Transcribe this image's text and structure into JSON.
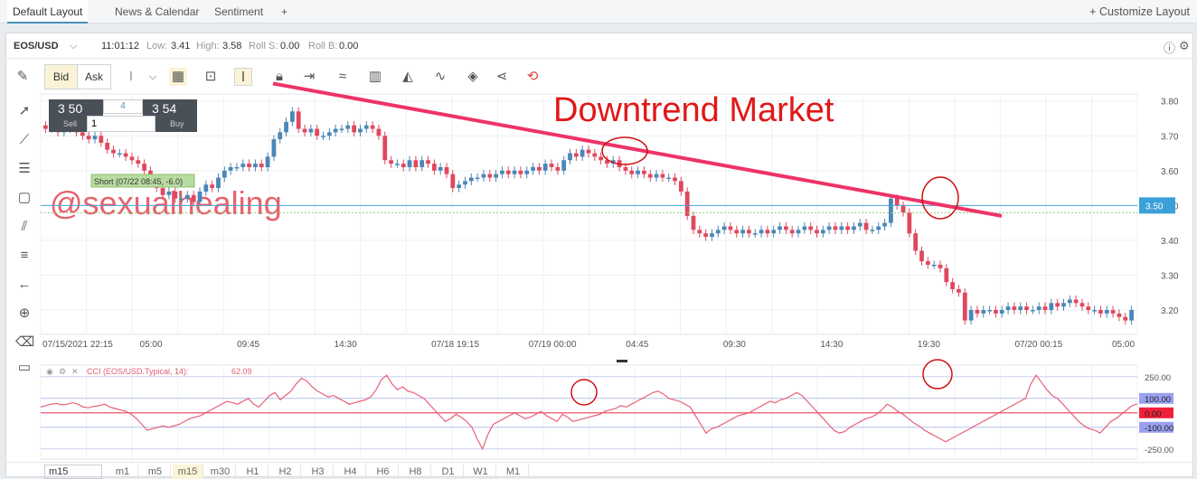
{
  "tabs": {
    "items": [
      "Default Layout",
      "News & Calendar",
      "Sentiment",
      "+"
    ],
    "customize": "+ Customize Layout"
  },
  "infobar": {
    "symbol": "EOS/USD",
    "chevron": "⌵",
    "time": "11:01:12",
    "low_label": "Low:",
    "low": "3.41",
    "high_label": "High:",
    "high": "3.58",
    "roll_s_label": "Roll S:",
    "roll_s": "0.00",
    "roll_b_label": "Roll B:",
    "roll_b": "0.00",
    "info_icon": "ⓘ",
    "settings_icon": "⚙"
  },
  "toolbar": {
    "bid": "Bid",
    "ask": "Ask"
  },
  "widget": {
    "sell_price": "3 50",
    "buy_price": "3 54",
    "sell_label": "Sell",
    "buy_label": "Buy",
    "spread": "4",
    "qty": "1"
  },
  "chart_data": {
    "type": "candlestick",
    "title": "Downtrend Market",
    "watermark": "@sexualhealing",
    "order_label": "Short (07/22 08:45, -6.0)",
    "current_price": "3.50",
    "ylim": [
      3.13,
      3.82
    ],
    "y_ticks": [
      "3.80",
      "3.70",
      "3.60",
      "3.50",
      "3.40",
      "3.30",
      "3.20"
    ],
    "y_tick_values": [
      3.8,
      3.7,
      3.6,
      3.5,
      3.4,
      3.3,
      3.2
    ],
    "x_ticks": [
      "07/15/2021 22:15",
      "05:00",
      "09:45",
      "14:30",
      "07/18 19:15",
      "07/19 00:00",
      "04:45",
      "09:30",
      "14:30",
      "19:30",
      "07/20 00:15",
      "05:00"
    ],
    "closes": [
      3.72,
      3.73,
      3.71,
      3.72,
      3.73,
      3.71,
      3.7,
      3.69,
      3.7,
      3.68,
      3.66,
      3.65,
      3.65,
      3.64,
      3.63,
      3.62,
      3.6,
      3.57,
      3.55,
      3.53,
      3.54,
      3.52,
      3.52,
      3.53,
      3.51,
      3.54,
      3.56,
      3.55,
      3.58,
      3.6,
      3.61,
      3.61,
      3.62,
      3.61,
      3.62,
      3.61,
      3.64,
      3.69,
      3.71,
      3.74,
      3.77,
      3.72,
      3.71,
      3.72,
      3.7,
      3.7,
      3.71,
      3.72,
      3.72,
      3.73,
      3.71,
      3.72,
      3.73,
      3.72,
      3.7,
      3.63,
      3.62,
      3.62,
      3.61,
      3.63,
      3.61,
      3.63,
      3.62,
      3.6,
      3.61,
      3.59,
      3.55,
      3.56,
      3.57,
      3.58,
      3.58,
      3.59,
      3.58,
      3.59,
      3.6,
      3.59,
      3.6,
      3.59,
      3.6,
      3.61,
      3.6,
      3.62,
      3.61,
      3.6,
      3.63,
      3.65,
      3.64,
      3.66,
      3.65,
      3.64,
      3.63,
      3.62,
      3.63,
      3.61,
      3.6,
      3.59,
      3.6,
      3.59,
      3.58,
      3.59,
      3.58,
      3.58,
      3.57,
      3.54,
      3.47,
      3.43,
      3.42,
      3.41,
      3.42,
      3.43,
      3.44,
      3.43,
      3.42,
      3.43,
      3.42,
      3.42,
      3.43,
      3.42,
      3.43,
      3.44,
      3.43,
      3.42,
      3.43,
      3.44,
      3.43,
      3.42,
      3.43,
      3.44,
      3.43,
      3.44,
      3.43,
      3.44,
      3.45,
      3.43,
      3.43,
      3.44,
      3.45,
      3.52,
      3.5,
      3.48,
      3.42,
      3.37,
      3.34,
      3.33,
      3.33,
      3.32,
      3.28,
      3.26,
      3.25,
      3.17,
      3.2,
      3.19,
      3.2,
      3.2,
      3.19,
      3.2,
      3.21,
      3.2,
      3.21,
      3.2,
      3.2,
      3.21,
      3.2,
      3.22,
      3.21,
      3.22,
      3.23,
      3.22,
      3.21,
      3.2,
      3.2,
      3.19,
      3.2,
      3.19,
      3.18,
      3.17,
      3.2
    ],
    "trendline": {
      "start_price": 3.85,
      "end_price": 3.47
    },
    "indicator": {
      "label": "CCI (EOS/USD.Typical, 14):",
      "value": "62.09",
      "ylim": [
        -320,
        330
      ],
      "y_ticks": [
        "250.00",
        "100.00",
        "0.00",
        "-100.00",
        "-250.00"
      ],
      "y_tick_values": [
        250,
        100,
        0,
        -100,
        -250
      ],
      "highlight_labels": [
        "100.00",
        "0.00",
        "-100.00"
      ],
      "values": [
        40,
        50,
        60,
        65,
        55,
        60,
        70,
        60,
        40,
        35,
        45,
        50,
        60,
        40,
        30,
        20,
        10,
        -10,
        -40,
        -80,
        -120,
        -110,
        -100,
        -90,
        -100,
        -90,
        -80,
        -60,
        -40,
        -30,
        -20,
        0,
        20,
        40,
        60,
        80,
        70,
        60,
        80,
        100,
        60,
        40,
        80,
        120,
        140,
        90,
        120,
        150,
        200,
        240,
        220,
        180,
        150,
        130,
        110,
        120,
        100,
        80,
        60,
        70,
        80,
        90,
        110,
        160,
        230,
        260,
        200,
        160,
        180,
        150,
        140,
        120,
        100,
        60,
        20,
        -20,
        -60,
        -40,
        -10,
        -30,
        -60,
        -100,
        -180,
        -250,
        -150,
        -80,
        -60,
        -40,
        -20,
        0,
        -20,
        -40,
        -30,
        -10,
        10,
        -20,
        -40,
        -60,
        -10,
        -30,
        -60,
        -50,
        -40,
        -30,
        -20,
        -10,
        10,
        20,
        30,
        50,
        40,
        60,
        80,
        100,
        120,
        140,
        150,
        130,
        100,
        90,
        80,
        60,
        40,
        -20,
        -80,
        -140,
        -110,
        -100,
        -80,
        -60,
        -40,
        -20,
        -10,
        0,
        20,
        40,
        60,
        80,
        70,
        90,
        100,
        120,
        140,
        120,
        80,
        40,
        0,
        -40,
        -80,
        -120,
        -140,
        -130,
        -100,
        -80,
        -60,
        -40,
        -30,
        -10,
        20,
        60,
        40,
        10,
        -10,
        -40,
        -70,
        -90,
        -120,
        -140,
        -160,
        -180,
        -200,
        -180,
        -160,
        -140,
        -120,
        -100,
        -80,
        -60,
        -40,
        -20,
        0,
        20,
        40,
        60,
        80,
        100,
        200,
        260,
        210,
        160,
        120,
        100,
        60,
        20,
        -20,
        -60,
        -90,
        -110,
        -120,
        -140,
        -100,
        -60,
        -40,
        -10,
        20,
        50,
        62
      ]
    }
  },
  "colors": {
    "up": "#4a87b8",
    "down": "#e0485e",
    "trend": "#ee3366",
    "annotation": "#d01010",
    "price_line": "#4aa6d8",
    "cci": "#e86078"
  },
  "bottombar": {
    "input": "m15",
    "timeframes": [
      "m1",
      "m5",
      "m15",
      "m30",
      "H1",
      "H2",
      "H3",
      "H4",
      "H6",
      "H8",
      "D1",
      "W1",
      "M1"
    ]
  }
}
